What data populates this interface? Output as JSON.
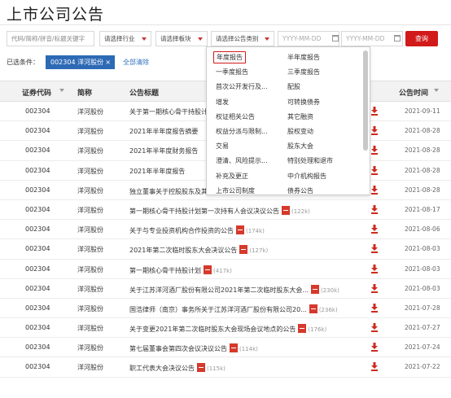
{
  "page": {
    "title": "上市公司公告"
  },
  "filters": {
    "keyword_placeholder": "代码/简称/拼音/标题关键字",
    "industry_label": "请选择行业",
    "board_label": "请选择板块",
    "category_label": "请选择公告类别",
    "date_start_placeholder": "YYYY-MM-DD",
    "date_end_placeholder": "YYYY-MM-DD",
    "search_label": "查询"
  },
  "selected": {
    "label": "已选条件：",
    "chip": "002304 洋河股份",
    "chip_remove": "×",
    "clear_all": "全部清除"
  },
  "table": {
    "headers": {
      "code": "证券代码",
      "name": "简称",
      "title": "公告标题",
      "time": "公告时间"
    },
    "rows": [
      {
        "code": "002304",
        "name": "洋河股份",
        "title": "关于第一期核心骨干持股计划",
        "size": "",
        "date": "2021-09-11"
      },
      {
        "code": "002304",
        "name": "洋河股份",
        "title": "2021年半年度报告摘要",
        "size": "",
        "date": "2021-08-28"
      },
      {
        "code": "002304",
        "name": "洋河股份",
        "title": "2021年半年度财务报告",
        "size": "",
        "date": "2021-08-28"
      },
      {
        "code": "002304",
        "name": "洋河股份",
        "title": "2021年半年度报告",
        "size": "",
        "date": "2021-08-28"
      },
      {
        "code": "002304",
        "name": "洋河股份",
        "title": "独立董事关于控股股东及其他关联方占用公司资金、公司对",
        "size": "(184k)",
        "date": "2021-08-28"
      },
      {
        "code": "002304",
        "name": "洋河股份",
        "title": "第一期核心骨干持股计划第一次持有人会议决议公告",
        "size": "(122k)",
        "date": "2021-08-17"
      },
      {
        "code": "002304",
        "name": "洋河股份",
        "title": "关于与专业投资机构合作投资的公告",
        "size": "(174k)",
        "date": "2021-08-06"
      },
      {
        "code": "002304",
        "name": "洋河股份",
        "title": "2021年第二次临时股东大会决议公告",
        "size": "(127k)",
        "date": "2021-08-03"
      },
      {
        "code": "002304",
        "name": "洋河股份",
        "title": "第一期核心骨干持股计划",
        "size": "(417k)",
        "date": "2021-08-03"
      },
      {
        "code": "002304",
        "name": "洋河股份",
        "title": "关于江苏洋河酒厂股份有限公司2021年第二次临时股东大会...",
        "size": "(230k)",
        "date": "2021-08-03"
      },
      {
        "code": "002304",
        "name": "洋河股份",
        "title": "国浩律师（南京）事务所关于江苏洋河酒厂股份有限公司20...",
        "size": "(236k)",
        "date": "2021-07-28"
      },
      {
        "code": "002304",
        "name": "洋河股份",
        "title": "关于变更2021年第二次临时股东大会现场会议地点的公告",
        "size": "(176k)",
        "date": "2021-07-27"
      },
      {
        "code": "002304",
        "name": "洋河股份",
        "title": "第七届董事会第四次会议决议公告",
        "size": "(114k)",
        "date": "2021-07-24"
      },
      {
        "code": "002304",
        "name": "洋河股份",
        "title": "职工代表大会决议公告",
        "size": "(115k)",
        "date": "2021-07-22"
      }
    ]
  },
  "dropdown": {
    "items": [
      {
        "left": "年度报告",
        "right": "半年度报告"
      },
      {
        "left": "一季度报告",
        "right": "三季度报告"
      },
      {
        "left": "首次公开发行及...",
        "right": "配股"
      },
      {
        "left": "增发",
        "right": "可转换债券"
      },
      {
        "left": "权证相关公告",
        "right": "其它融资"
      },
      {
        "left": "权益分派与限制...",
        "right": "股权变动"
      },
      {
        "left": "交易",
        "right": "股东大会"
      },
      {
        "left": "澄清、风险提示...",
        "right": "特别处理和退市"
      },
      {
        "left": "补充及更正",
        "right": "中介机构报告"
      },
      {
        "left": "上市公司制度",
        "right": "债券公告"
      }
    ]
  },
  "colors": {
    "accent": "#d21a1a",
    "chip": "#2d6ab5",
    "link": "#3070c0"
  }
}
